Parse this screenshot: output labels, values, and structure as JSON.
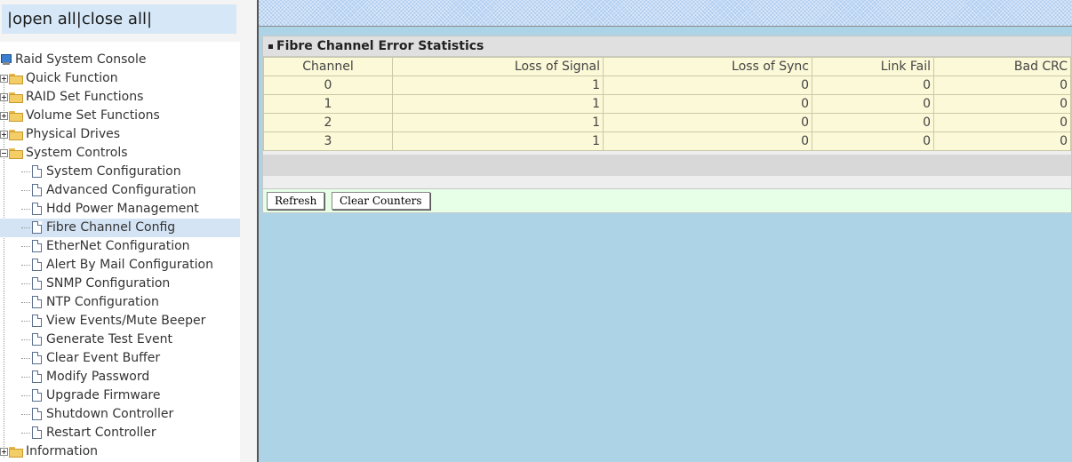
{
  "left": {
    "open_all": "open all",
    "close_all": "close all",
    "sep1": "|",
    "sep2": "|",
    "sep3": "|",
    "root": "Raid System Console",
    "menus": [
      {
        "label": "Quick Function"
      },
      {
        "label": "RAID Set Functions"
      },
      {
        "label": "Volume Set Functions"
      },
      {
        "label": "Physical Drives"
      },
      {
        "label": "System Controls"
      }
    ],
    "system_controls_items": [
      "System Configuration",
      "Advanced Configuration",
      "Hdd Power Management",
      "Fibre Channel Config",
      "EtherNet Configuration",
      "Alert By Mail Configuration",
      "SNMP Configuration",
      "NTP Configuration",
      "View Events/Mute Beeper",
      "Generate Test Event",
      "Clear Event Buffer",
      "Modify Password",
      "Upgrade Firmware",
      "Shutdown Controller",
      "Restart Controller"
    ],
    "information": "Information",
    "selected": "Fibre Channel Config"
  },
  "panel": {
    "title": "Fibre Channel Error Statistics",
    "columns": [
      "Channel",
      "Loss of Signal",
      "Loss of Sync",
      "Link Fail",
      "Bad CRC"
    ],
    "rows": [
      [
        "0",
        "1",
        "0",
        "0",
        "0"
      ],
      [
        "1",
        "1",
        "0",
        "0",
        "0"
      ],
      [
        "2",
        "1",
        "0",
        "0",
        "0"
      ],
      [
        "3",
        "1",
        "0",
        "0",
        "0"
      ]
    ],
    "refresh_label": "Refresh",
    "clear_label": "Clear Counters"
  },
  "colors": {
    "content_bg": "#add4e6",
    "table_bg": "#fcf9d8",
    "button_bar_bg": "#e6ffe6",
    "selected_bg": "#d4e4f4"
  }
}
